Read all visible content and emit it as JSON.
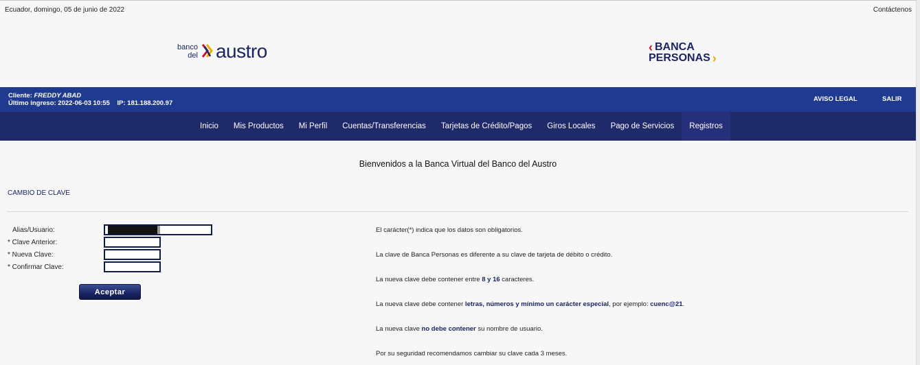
{
  "header": {
    "date": "Ecuador, domingo, 05 de junio de 2022",
    "contact": "Contáctenos"
  },
  "logo_austro": {
    "small_top": "banco",
    "small_bottom": "del",
    "big": "austro"
  },
  "logo_banca": {
    "line1": "BANCA",
    "line2": "PERSONAS"
  },
  "client_bar": {
    "client_prefix": "Cliente:",
    "client_name": "FREDDY ABAD",
    "last_login": "Último ingreso: 2022-06-03 10:55",
    "ip": "IP: 181.188.200.97",
    "aviso": "AVISO LEGAL",
    "salir": "SALIR"
  },
  "nav": {
    "items": [
      "Inicio",
      "Mis Productos",
      "Mi Perfil",
      "Cuentas/Transferencias",
      "Tarjetas de Crédito/Pagos",
      "Giros Locales",
      "Pago de Servicios",
      "Registros"
    ]
  },
  "main": {
    "welcome": "Bienvenidos a la Banca Virtual del Banco del Austro",
    "section_title": "CAMBIO DE CLAVE",
    "form": {
      "alias_label": "Alias/Usuario:",
      "clave_anterior_label": "* Clave Anterior:",
      "nueva_clave_label": "* Nueva Clave:",
      "confirmar_label": "* Confirmar Clave:",
      "accept_label": "Aceptar"
    },
    "info": {
      "l1": "El carácter(*) indica que los datos son obligatorios.",
      "l2": "La clave de Banca Personas es diferente a su clave de tarjeta de débito o crédito.",
      "l3a": "La nueva clave debe contener entre ",
      "l3b": "8 y 16",
      "l3c": " caracteres.",
      "l4a": "La nueva clave debe contener ",
      "l4b": "letras, números y mínimo un carácter especial",
      "l4c": ", por ejemplo: ",
      "l4d": "cuenc@21",
      "l4e": ".",
      "l5a": "La nueva clave ",
      "l5b": "no debe contener",
      "l5c": " su nombre de usuario.",
      "l6": "Por su seguridad recomendamos cambiar su clave cada 3 meses."
    }
  },
  "colors": {
    "client_bar": "#1f3a8f",
    "nav_bar": "#1f2a6b",
    "brand_navy": "#1a2463",
    "brand_red": "#c8102e",
    "brand_gold": "#f2a900"
  }
}
